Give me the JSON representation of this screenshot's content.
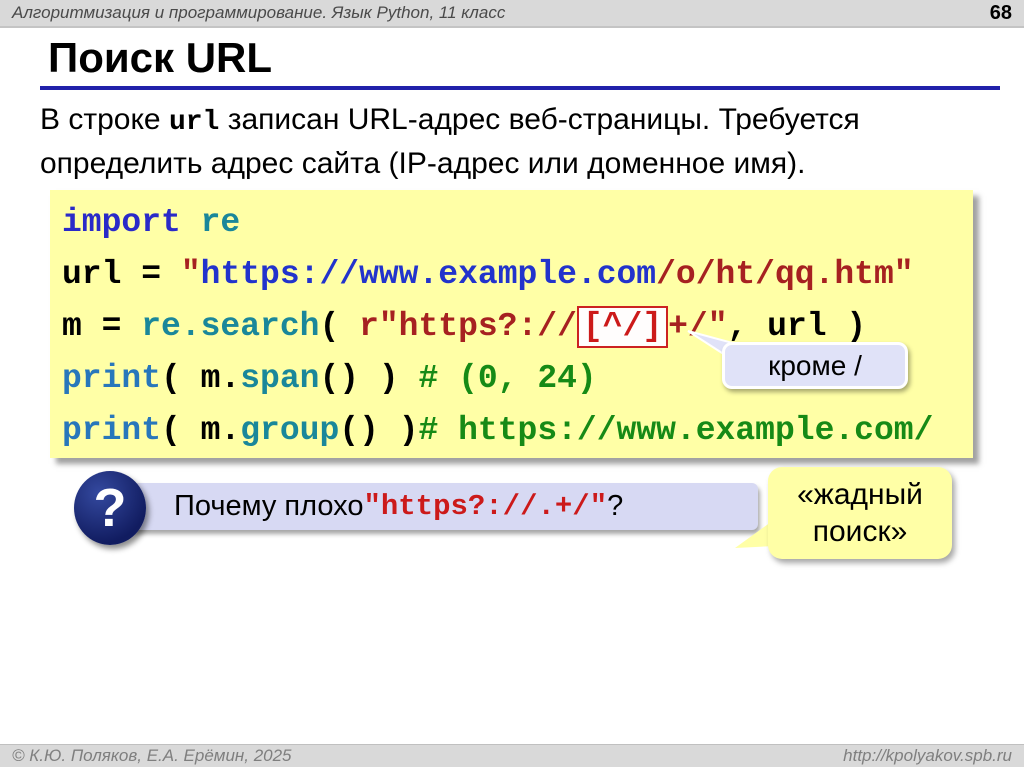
{
  "header": {
    "course": "Алгоритмизация и программирование. Язык Python, 11 класс",
    "page": "68"
  },
  "title": "Поиск URL",
  "intro": {
    "before": "В строке ",
    "var": "url",
    "after": " записан URL-адрес веб-страницы. Требуется определить адрес сайта (IP-адрес или доменное имя)."
  },
  "code": {
    "l1_kw": "import ",
    "l1_mod": "re",
    "l2_var": "url = ",
    "l2_q1": "\"",
    "l2_link": "https://www.example.com",
    "l2_rest": "/o/ht/qq.htm\"",
    "l3_pre": "m = ",
    "l3_fn": "re.search",
    "l3_par": "( ",
    "l3_str1": "r\"https?://",
    "l3_boxed": "[^/]",
    "l3_str2": "+/\"",
    "l3_end": ", url )",
    "l4_print": "print",
    "l4_p1": "( m.",
    "l4_fn": "span",
    "l4_p2": "() ) ",
    "l4_comment": "# (0, 24)",
    "l5_print": "print",
    "l5_p1": "( m.",
    "l5_fn": "group",
    "l5_p2": "() )",
    "l5_comment": "# https://www.example.com/"
  },
  "callouts": {
    "krome": "кроме /",
    "greedy_line1": "«жадный",
    "greedy_line2": "поиск»"
  },
  "question": {
    "icon": "?",
    "prefix": "Почему плохо ",
    "code": "\"https?://.+/\"",
    "suffix": "?"
  },
  "footer": {
    "left": "© К.Ю. Поляков, Е.А. Ерёмин, 2025",
    "right": "http://kpolyakov.spb.ru"
  },
  "colors": {
    "accent_rule": "#2121aa",
    "code_background": "#ffffa6",
    "keyword_blue": "#2a2ac8",
    "function_teal": "#1a879a",
    "print_blue": "#2877bb",
    "string_red": "#a62121",
    "link_blue": "#2233cc",
    "comment_green": "#168a16",
    "regex_box_border": "#cc2222",
    "callout_lavender": "#e0e2f8",
    "question_bar": "#d7d9f3",
    "question_circle": "#1a2a7a",
    "callout_yellow": "#ffffa6",
    "bar_gray": "#d9d9d9"
  }
}
